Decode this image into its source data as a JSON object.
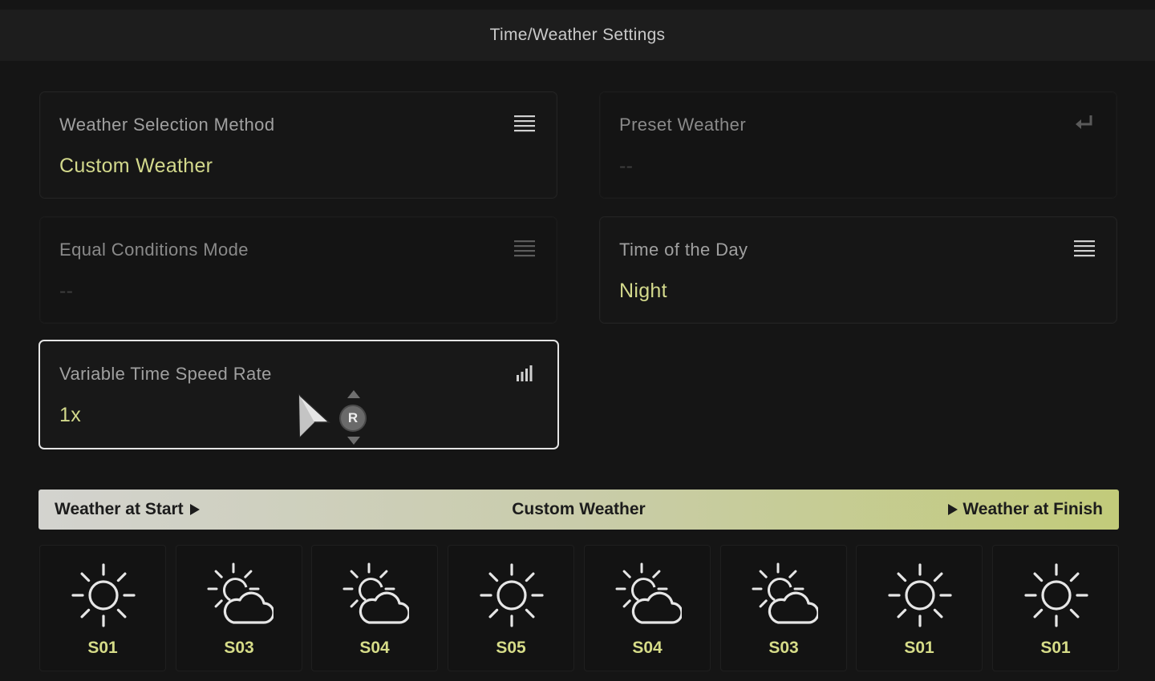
{
  "title": "Time/Weather Settings",
  "cards": {
    "weather_method": {
      "label": "Weather Selection Method",
      "value": "Custom Weather",
      "icon": "list-icon"
    },
    "preset_weather": {
      "label": "Preset Weather",
      "value": "--",
      "icon": "enter-icon"
    },
    "equal_conditions": {
      "label": "Equal Conditions Mode",
      "value": "--",
      "icon": "list-icon"
    },
    "time_of_day": {
      "label": "Time of the Day",
      "value": "Night",
      "icon": "list-icon"
    },
    "time_speed": {
      "label": "Variable Time Speed Rate",
      "value": "1x",
      "icon": "signal-bars-icon"
    }
  },
  "controller": {
    "r_button": "R"
  },
  "banner": {
    "left": "Weather at Start",
    "center": "Custom Weather",
    "right": "Weather at Finish"
  },
  "slots": [
    {
      "label": "S01",
      "icon": "sun-icon"
    },
    {
      "label": "S03",
      "icon": "partly-cloudy-icon"
    },
    {
      "label": "S04",
      "icon": "partly-cloudy-icon"
    },
    {
      "label": "S05",
      "icon": "sun-icon"
    },
    {
      "label": "S04",
      "icon": "partly-cloudy-icon"
    },
    {
      "label": "S03",
      "icon": "partly-cloudy-icon"
    },
    {
      "label": "S01",
      "icon": "sun-icon"
    },
    {
      "label": "S01",
      "icon": "sun-icon"
    }
  ],
  "colors": {
    "accent_value": "#d3d98c",
    "background": "#151515",
    "banner_start": "#d3d3cf",
    "banner_end": "#c2cb7a"
  }
}
